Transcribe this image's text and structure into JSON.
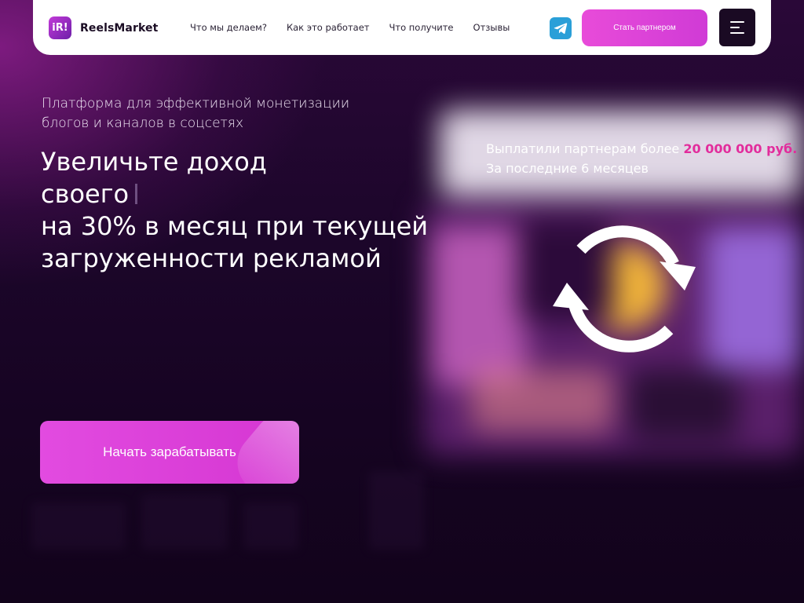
{
  "header": {
    "logo_mark": "iR!",
    "logo_text": "ReelsMarket",
    "nav": [
      "Что мы делаем?",
      "Как это работает",
      "Что получите",
      "Отзывы"
    ],
    "telegram_icon": "telegram-icon",
    "partner_button": "Стать партнером",
    "menu_icon": "hamburger-menu-icon"
  },
  "hero": {
    "subtitle_line1": "Платформа для эффективной монетизации",
    "subtitle_line2": "блогов и каналов в соцсетях",
    "title_line1": "Увеличьте доход",
    "title_line2": "своего",
    "title_line3": "на 30% в месяц при текущей",
    "title_line4": "загруженности рекламой",
    "payout_prefix": "Выплатили партнерам более ",
    "payout_amount": "20 000 000 руб.",
    "payout_period": "За последние 6 месяцев",
    "sync_icon": "sync-icon",
    "cta_label": "Начать зарабатывать"
  },
  "colors": {
    "accent": "#e24be0",
    "highlight": "#e22c9c",
    "background": "#170522",
    "header_bg": "#ffffff"
  }
}
